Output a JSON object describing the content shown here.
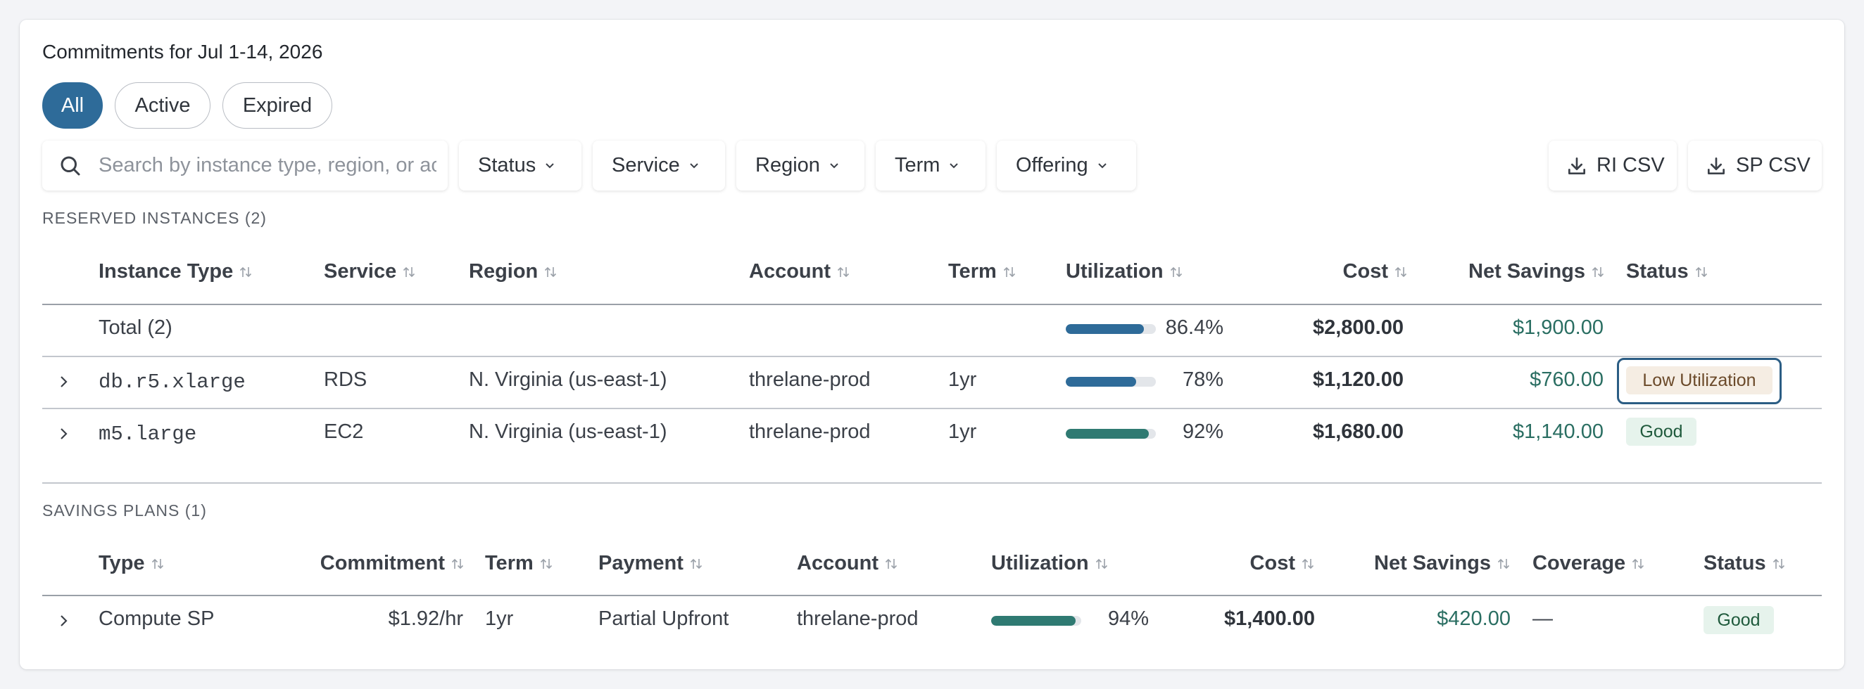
{
  "title": "Commitments for Jul 1-14, 2026",
  "tabs": [
    {
      "label": "All",
      "active": true
    },
    {
      "label": "Active",
      "active": false
    },
    {
      "label": "Expired",
      "active": false
    }
  ],
  "search": {
    "placeholder": "Search by instance type, region, or account",
    "value": ""
  },
  "filters": [
    "Status",
    "Service",
    "Region",
    "Term",
    "Offering"
  ],
  "exports": {
    "ri_csv": "RI CSV",
    "sp_csv": "SP CSV"
  },
  "colors": {
    "accent": "#2e6b99",
    "bar_blue": "#2e6b99",
    "bar_green": "#2f7a72",
    "savings_green": "#2a6e62"
  },
  "reserved_instances": {
    "section_label": "RESERVED INSTANCES (2)",
    "headers": [
      "Instance Type",
      "Service",
      "Region",
      "Account",
      "Term",
      "Utilization",
      "Cost",
      "Net Savings",
      "Status"
    ],
    "total": {
      "label": "Total (2)",
      "utilization": 86.4,
      "utilization_label": "86.4%",
      "cost": "$2,800.00",
      "net_savings": "$1,900.00"
    },
    "rows": [
      {
        "instance_type": "db.r5.xlarge",
        "service": "RDS",
        "region": "N. Virginia (us-east-1)",
        "account": "threlane-prod",
        "term": "1yr",
        "utilization": 78,
        "utilization_label": "78%",
        "cost": "$1,120.00",
        "net_savings": "$760.00",
        "status": "Low Utilization"
      },
      {
        "instance_type": "m5.large",
        "service": "EC2",
        "region": "N. Virginia (us-east-1)",
        "account": "threlane-prod",
        "term": "1yr",
        "utilization": 92,
        "utilization_label": "92%",
        "cost": "$1,680.00",
        "net_savings": "$1,140.00",
        "status": "Good"
      }
    ]
  },
  "savings_plans": {
    "section_label": "SAVINGS PLANS (1)",
    "headers": [
      "Type",
      "Commitment",
      "Term",
      "Payment",
      "Account",
      "Utilization",
      "Cost",
      "Net Savings",
      "Coverage",
      "Status"
    ],
    "rows": [
      {
        "type": "Compute SP",
        "commitment": "$1.92/hr",
        "term": "1yr",
        "payment": "Partial Upfront",
        "account": "threlane-prod",
        "utilization": 94,
        "utilization_label": "94%",
        "cost": "$1,400.00",
        "net_savings": "$420.00",
        "coverage": "—",
        "status": "Good"
      }
    ]
  }
}
